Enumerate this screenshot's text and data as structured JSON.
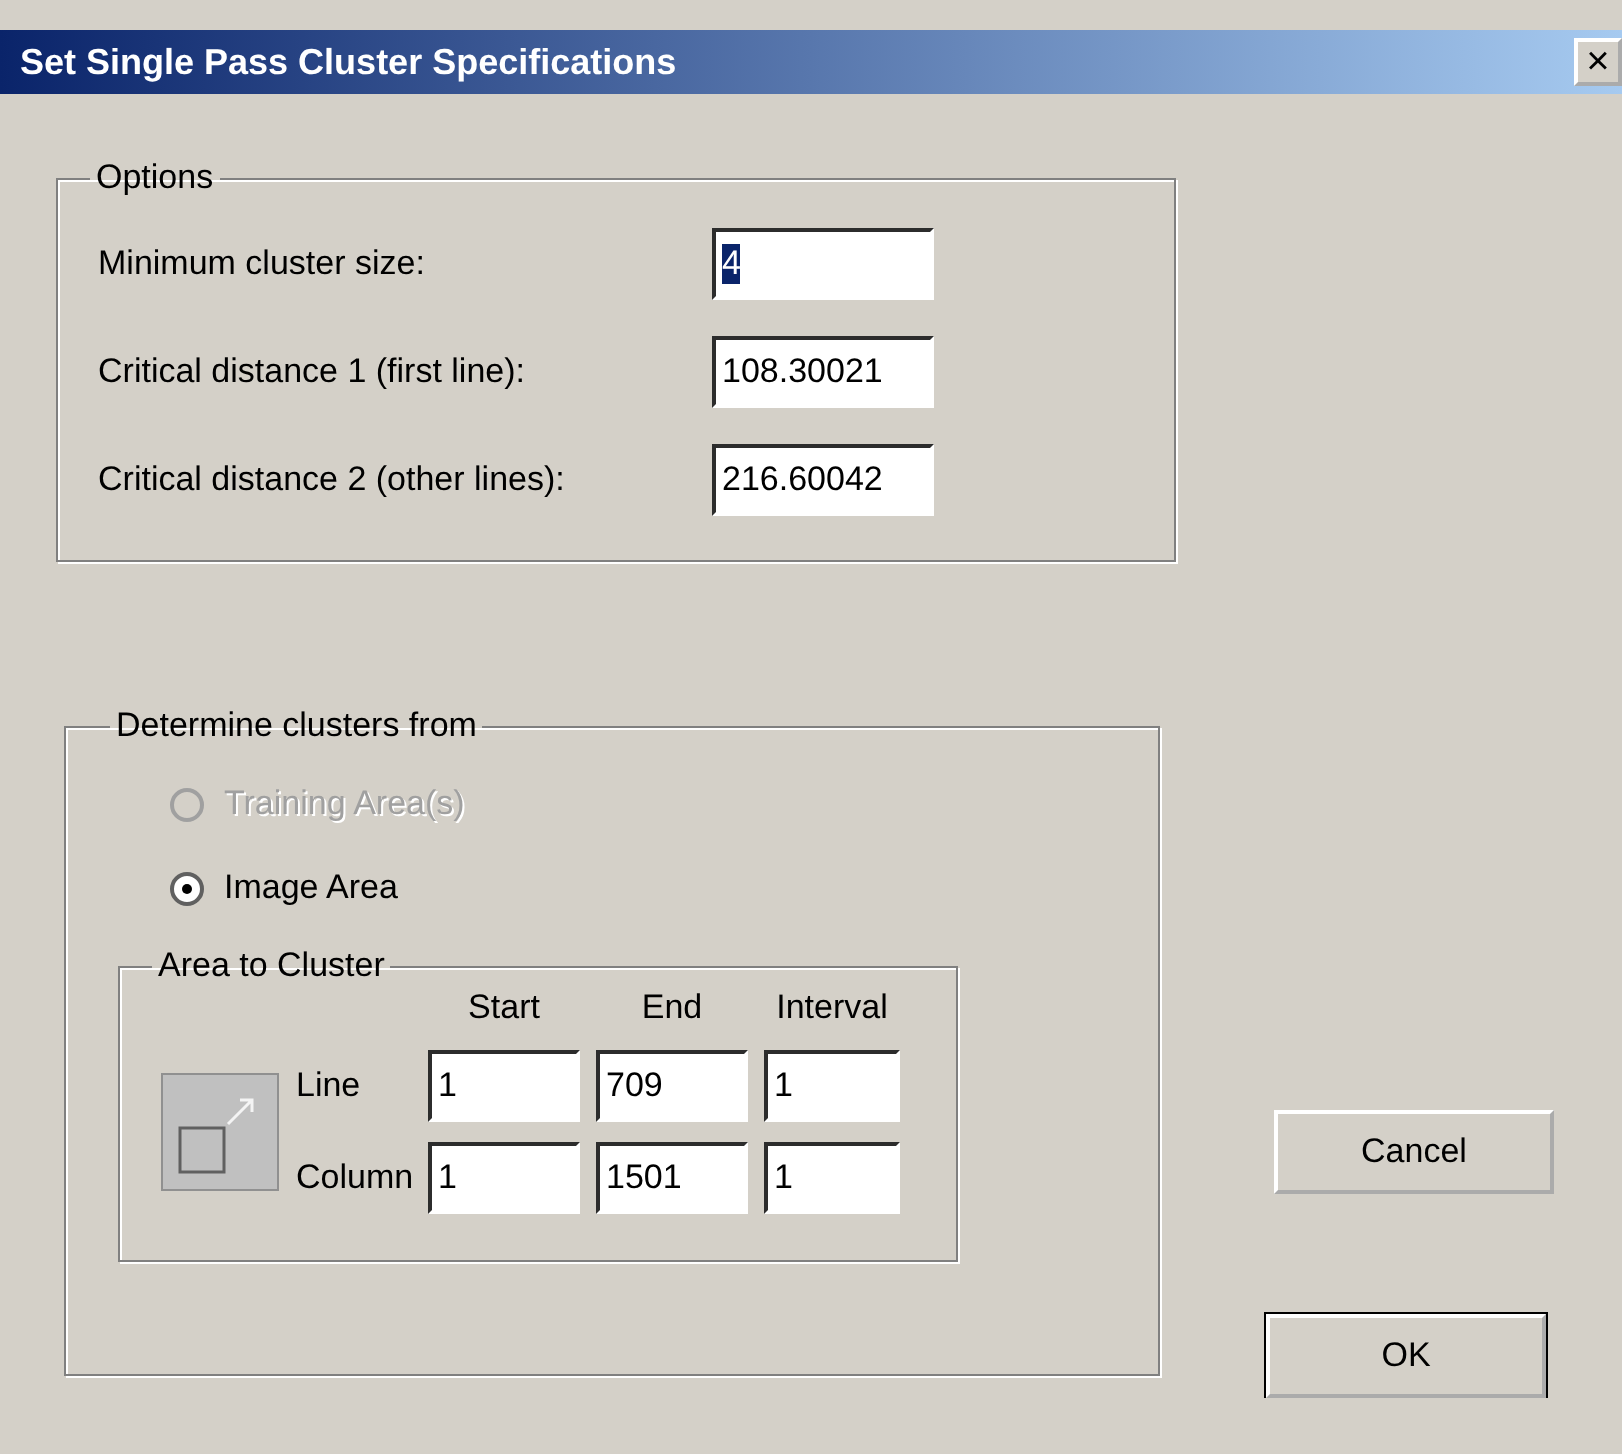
{
  "window": {
    "title": "Set Single Pass Cluster Specifications",
    "close_label": "×"
  },
  "options": {
    "legend": "Options",
    "fields": [
      {
        "label": "Minimum cluster size:",
        "value": "4",
        "text_selected": true
      },
      {
        "label": "Critical distance 1 (first line):",
        "value": "108.30021",
        "text_selected": false
      },
      {
        "label": "Critical distance 2 (other lines):",
        "value": "216.60042",
        "text_selected": false
      }
    ]
  },
  "determine": {
    "legend": "Determine clusters from",
    "radios": [
      {
        "label": "Training Area(s)",
        "selected": false,
        "disabled": true
      },
      {
        "label": "Image Area",
        "selected": true,
        "disabled": false
      }
    ],
    "area": {
      "legend": "Area to Cluster",
      "columns": [
        "Start",
        "End",
        "Interval"
      ],
      "rows": [
        {
          "label": "Line",
          "values": [
            "1",
            "709",
            "1"
          ]
        },
        {
          "label": "Column",
          "values": [
            "1",
            "1501",
            "1"
          ]
        }
      ]
    }
  },
  "buttons": [
    {
      "label": "Cancel",
      "default": false
    },
    {
      "label": "OK",
      "default": true
    }
  ]
}
